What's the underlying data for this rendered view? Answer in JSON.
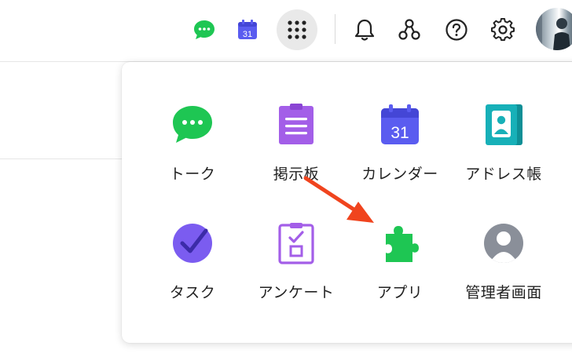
{
  "topbar": {
    "icons": [
      "talk-icon",
      "calendar-icon",
      "apps-grid-icon",
      "bell-icon",
      "org-chart-icon",
      "help-icon",
      "gear-icon",
      "avatar"
    ],
    "calendar_day": "31"
  },
  "apps_menu": {
    "items": [
      {
        "label": "トーク",
        "icon": "talk-icon",
        "color": "#1ec653"
      },
      {
        "label": "掲示板",
        "icon": "board-icon",
        "color": "#a35ee8"
      },
      {
        "label": "カレンダー",
        "icon": "calendar-icon",
        "color": "#5a5cf0",
        "day": "31"
      },
      {
        "label": "アドレス帳",
        "icon": "address-book-icon",
        "color": "#17b0b8"
      },
      {
        "label": "タスク",
        "icon": "task-icon",
        "color": "#7b5cf0"
      },
      {
        "label": "アンケート",
        "icon": "survey-icon",
        "color": "#a35ee8"
      },
      {
        "label": "アプリ",
        "icon": "puzzle-icon",
        "color": "#1ec653"
      },
      {
        "label": "管理者画面",
        "icon": "admin-icon",
        "color": "#8a8f99"
      }
    ]
  },
  "colors": {
    "accent_green": "#1ec653",
    "accent_purple": "#a35ee8",
    "accent_indigo": "#5a5cf0",
    "accent_teal": "#17b0b8",
    "annotation_arrow": "#f0441e"
  }
}
